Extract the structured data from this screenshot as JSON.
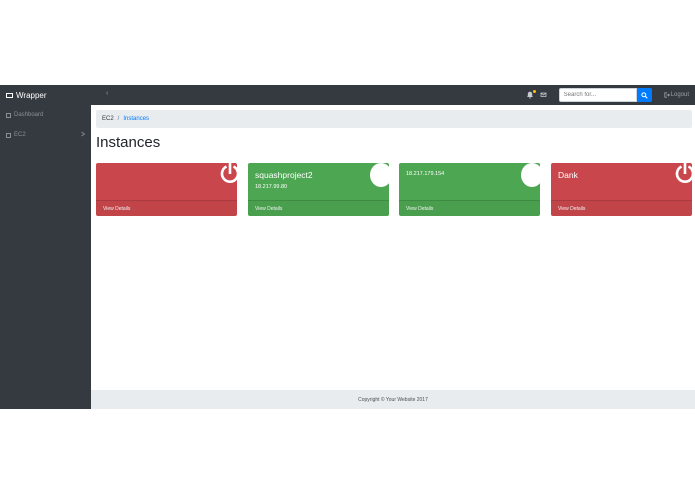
{
  "navbar": {
    "brand": "Wrapper",
    "toggler": "‹",
    "search_placeholder": "Search for...",
    "logout_label": "Logout"
  },
  "sidebar": {
    "items": [
      {
        "label": "Dashboard",
        "icon": "dashboard-icon"
      },
      {
        "label": "EC2",
        "icon": "server-icon"
      }
    ]
  },
  "breadcrumb": {
    "parent": "EC2",
    "current": "Instances"
  },
  "page": {
    "title": "Instances"
  },
  "instances": [
    {
      "name": "",
      "ip": "",
      "status": "stopped",
      "color": "#c9474c",
      "link": "View Details"
    },
    {
      "name": "squashproject2",
      "ip": "18.217.99.80",
      "status": "running",
      "color": "#4da652",
      "link": "View Details"
    },
    {
      "name": "",
      "ip": "18.217.179.154",
      "status": "running",
      "color": "#4da652",
      "link": "View Details"
    },
    {
      "name": "Dank",
      "ip": "",
      "status": "stopped",
      "color": "#c9474c",
      "link": "View Details"
    }
  ],
  "footer": {
    "copyright": "Copyright © Your Website 2017"
  },
  "colors": {
    "navbar": "#343a40",
    "accent": "#007bff",
    "stopped": "#c9474c",
    "running": "#4da652"
  }
}
